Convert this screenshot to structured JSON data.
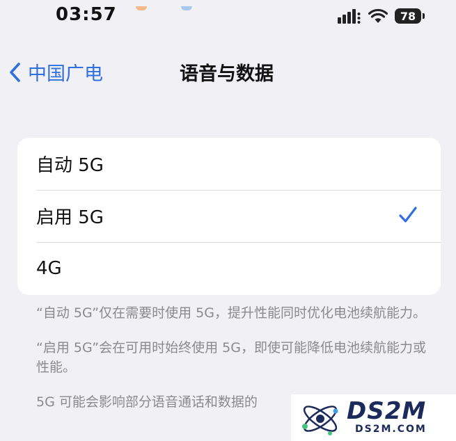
{
  "status_bar": {
    "time": "03:57",
    "battery": "78",
    "icons": [
      "signal-icon",
      "wifi-icon",
      "battery-icon"
    ]
  },
  "nav": {
    "back_label": "中国广电",
    "title": "语音与数据"
  },
  "options": [
    {
      "label": "自动 5G",
      "selected": false
    },
    {
      "label": "启用 5G",
      "selected": true
    },
    {
      "label": "4G",
      "selected": false
    }
  ],
  "notes": [
    "“自动 5G”仅在需要时使用 5G，提升性能同时优化电池续航能力。",
    "“启用 5G”会在可用时始终使用 5G，即使可能降低电池续航能力或性能。",
    "5G 可能会影响部分语音通话和数据的"
  ],
  "watermark": {
    "title": "DS2M",
    "subtitle": "DS2M.COM"
  },
  "colors": {
    "accent": "#2f6fde",
    "background": "#f0f0f5",
    "card": "#ffffff",
    "secondary_text": "#8a8a8e"
  }
}
